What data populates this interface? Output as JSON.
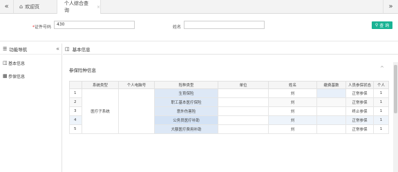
{
  "tabbar": {
    "nav_left": "«",
    "nav_right": "»",
    "home_label": "欢迎页",
    "active_label": "个人综合查询",
    "close_glyph": "×"
  },
  "search": {
    "id_label": "证件号码",
    "id_required": "*",
    "id_value": "430",
    "name_label": "姓名",
    "name_value": "",
    "search_button": "查 询"
  },
  "sidebar": {
    "title": "功能导航",
    "collapse_glyph": "«",
    "items": [
      {
        "label": "基本信息",
        "icon": "document-icon"
      },
      {
        "label": "参保信息",
        "icon": "grid-icon"
      }
    ]
  },
  "panel": {
    "title": "基本信息",
    "section_title": "参保险种信息",
    "section_toggle": "^"
  },
  "table": {
    "columns": [
      "",
      "系统类型",
      "个人电脑号",
      "险种类型",
      "单位",
      "姓名",
      "缴费基数",
      "人员参保状态",
      "个人"
    ],
    "system_type": "医疗子系统",
    "rows": [
      {
        "no": "1",
        "insure_type": "生育保险",
        "unit": "",
        "name": "刘",
        "base": "",
        "status": "正常参保",
        "extra": "1"
      },
      {
        "no": "2",
        "insure_type": "职工基本医疗保险",
        "unit": "",
        "name": "刘",
        "base": "",
        "status": "正常参保",
        "extra": "1"
      },
      {
        "no": "3",
        "insure_type": "意外伤害险",
        "unit": "",
        "name": "刘",
        "base": "",
        "status": "终止参保",
        "extra": "1"
      },
      {
        "no": "4",
        "insure_type": "公务员医疗补助",
        "unit": "",
        "name": "刘",
        "base": "",
        "status": "正常参保",
        "extra": "1"
      },
      {
        "no": "5",
        "insure_type": "大额医疗费用补助",
        "unit": "",
        "name": "刘",
        "base": "",
        "status": "正常参保",
        "extra": "1"
      }
    ]
  },
  "colors": {
    "accent": "#1ab394",
    "highlight": "#dde8f6"
  }
}
